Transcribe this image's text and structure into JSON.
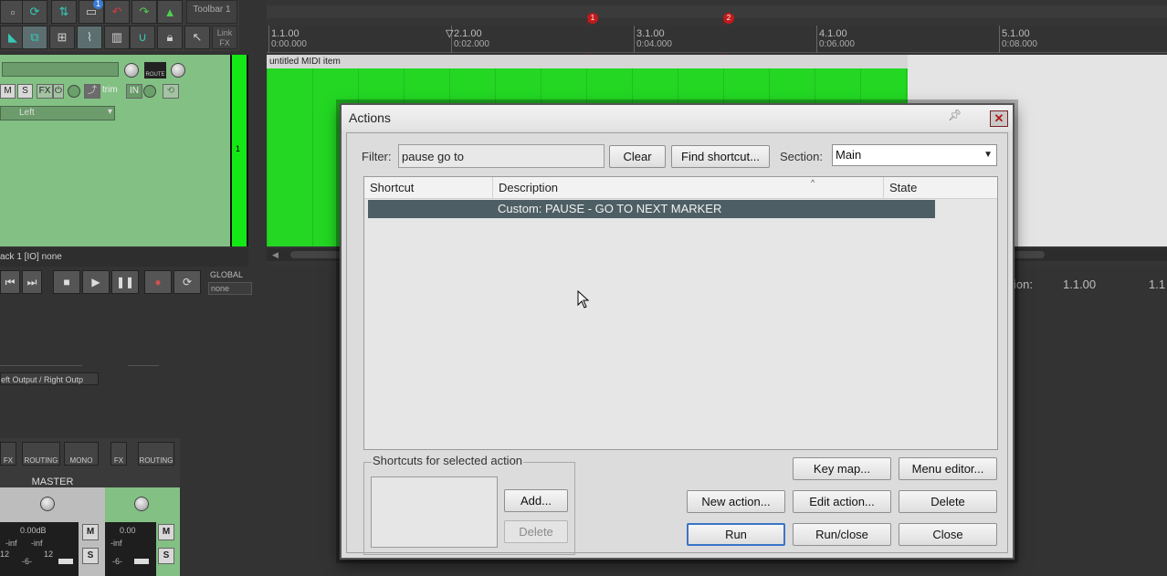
{
  "toolbar": {
    "title": "Toolbar 1",
    "link_fx": [
      "Link",
      "FX"
    ],
    "badge": "1"
  },
  "track": {
    "mute": "M",
    "solo": "S",
    "fx": "FX",
    "trim": "trim",
    "input": "IN",
    "route": "ROUTE",
    "input_channel": "Left",
    "number": "1",
    "io_text": "ack 1 [IO] none"
  },
  "transport": {
    "global_label": "GLOBAL",
    "global_value": "none",
    "position_label": "ion:",
    "position_value": "1.1.00",
    "position_value2": "1.1"
  },
  "mixer": {
    "output_label": "eft Output / Right Outp",
    "master_label": "MASTER",
    "routing": "ROUTING",
    "mono": "MONO",
    "master_volume": "0.00dB",
    "track_volume": "0.00",
    "inf_left": "-inf",
    "inf_right": "-inf",
    "scale_12": "12",
    "scale_6": "-6-",
    "fx": "FX",
    "mute": "M",
    "solo": "S"
  },
  "ruler": {
    "marks": [
      {
        "bar": "1.1.00",
        "time": "0:00.000"
      },
      {
        "bar": "2.1.00",
        "time": "0:02.000"
      },
      {
        "bar": "3.1.00",
        "time": "0:04.000"
      },
      {
        "bar": "4.1.00",
        "time": "0:06.000"
      },
      {
        "bar": "5.1.00",
        "time": "0:08.000"
      }
    ],
    "markers": [
      "1",
      "2"
    ]
  },
  "item": {
    "name": "untitled MIDI item"
  },
  "dialog": {
    "title": "Actions",
    "filter_label": "Filter:",
    "filter_value": "pause go to",
    "clear_button": "Clear",
    "find_shortcut_button": "Find shortcut...",
    "section_label": "Section:",
    "section_value": "Main",
    "columns": [
      "Shortcut",
      "Description",
      "State"
    ],
    "rows": [
      {
        "shortcut": "",
        "description": "Custom: PAUSE - GO TO NEXT MARKER",
        "state": ""
      }
    ],
    "shortcuts_group_label": "Shortcuts for selected action",
    "add_button": "Add...",
    "delete_shortcut_button": "Delete",
    "key_map_button": "Key map...",
    "menu_editor_button": "Menu editor...",
    "new_action_button": "New action...",
    "edit_action_button": "Edit action...",
    "delete_button": "Delete",
    "run_button": "Run",
    "run_close_button": "Run/close",
    "close_button": "Close"
  }
}
